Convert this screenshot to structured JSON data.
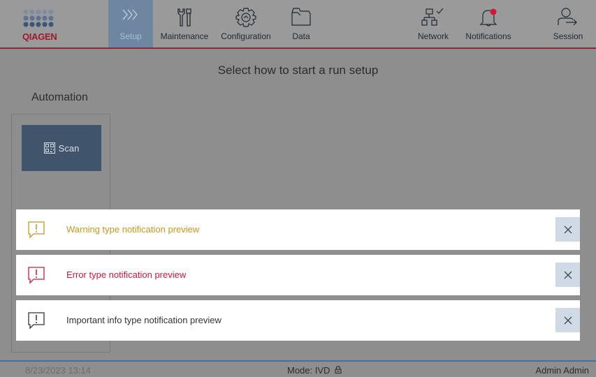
{
  "logo": {
    "text": "QIAGEN"
  },
  "nav": {
    "items": [
      {
        "label": "Setup",
        "icon": "chevrons-right-icon",
        "active": true
      },
      {
        "label": "Maintenance",
        "icon": "tools-icon",
        "active": false
      },
      {
        "label": "Configuration",
        "icon": "gear-icon",
        "active": false
      },
      {
        "label": "Data",
        "icon": "folder-icon",
        "active": false
      },
      {
        "label": "Network",
        "icon": "network-icon",
        "active": false
      },
      {
        "label": "Notifications",
        "icon": "bell-icon",
        "active": false
      },
      {
        "label": "Session",
        "icon": "user-logout-icon",
        "active": false
      }
    ]
  },
  "main": {
    "heading": "Select how to start a run setup",
    "automation_title": "Automation",
    "scan_label": "Scan"
  },
  "notifications": [
    {
      "type": "warning",
      "message": "Warning type notification preview",
      "color": "#c8961e"
    },
    {
      "type": "error",
      "message": "Error type notification preview",
      "color": "#d4163c"
    },
    {
      "type": "info",
      "message": "Important info type notification preview",
      "color": "#333333"
    }
  ],
  "status": {
    "datetime": "8/23/2023 13:14",
    "mode": "Mode: IVD",
    "user": "Admin Admin"
  },
  "colors": {
    "accent": "#6f86a0",
    "brand": "#9a1a2e",
    "warning": "#c8961e",
    "error": "#d4163c",
    "close_bg": "#cfdae4"
  }
}
